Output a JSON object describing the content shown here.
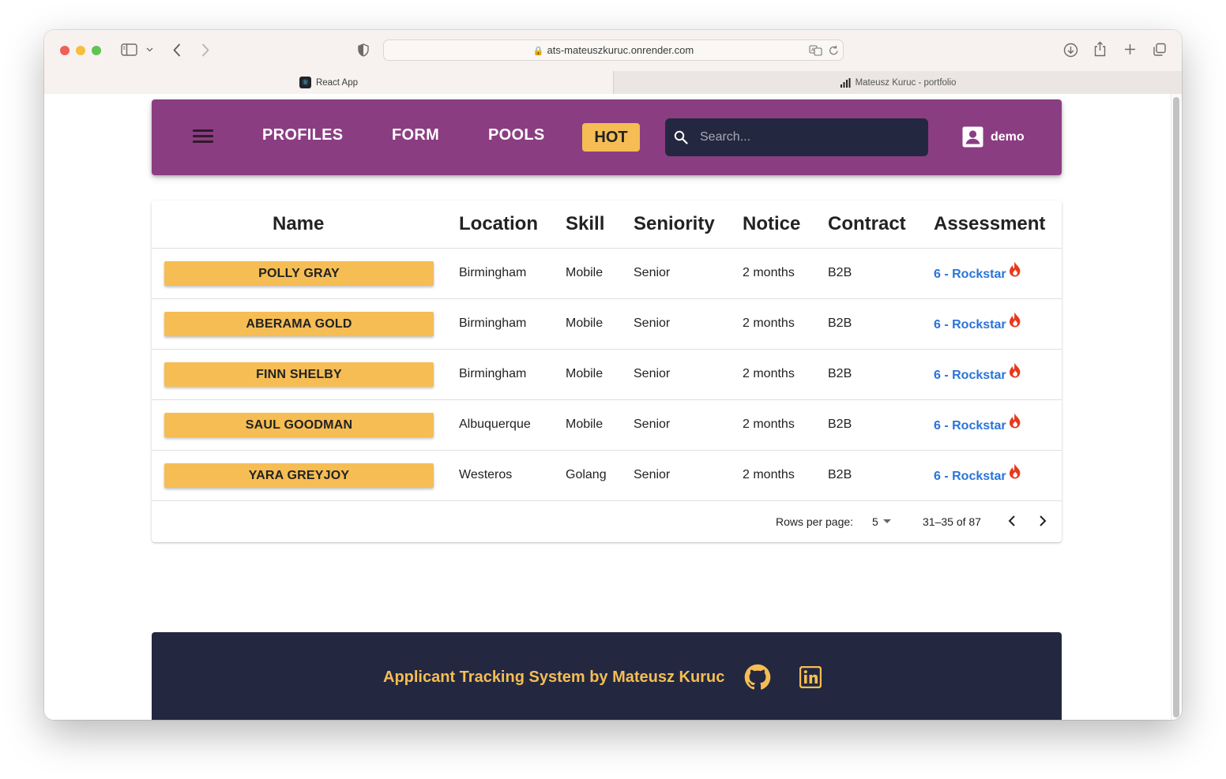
{
  "browser": {
    "url": "ats-mateuszkuruc.onrender.com",
    "tabs": [
      {
        "label": "React App"
      },
      {
        "label": "Mateusz Kuruc - portfolio"
      }
    ]
  },
  "appbar": {
    "nav": [
      "PROFILES",
      "FORM",
      "POOLS"
    ],
    "hot_label": "HOT",
    "search_placeholder": "Search...",
    "user": "demo"
  },
  "table": {
    "headers": [
      "Name",
      "Location",
      "Skill",
      "Seniority",
      "Notice",
      "Contract",
      "Assessment"
    ],
    "rows": [
      {
        "name": "POLLY GRAY",
        "location": "Birmingham",
        "skill": "Mobile",
        "seniority": "Senior",
        "notice": "2 months",
        "contract": "B2B",
        "assessment": "6 - Rockstar"
      },
      {
        "name": "ABERAMA GOLD",
        "location": "Birmingham",
        "skill": "Mobile",
        "seniority": "Senior",
        "notice": "2 months",
        "contract": "B2B",
        "assessment": "6 - Rockstar"
      },
      {
        "name": "FINN SHELBY",
        "location": "Birmingham",
        "skill": "Mobile",
        "seniority": "Senior",
        "notice": "2 months",
        "contract": "B2B",
        "assessment": "6 - Rockstar"
      },
      {
        "name": "SAUL GOODMAN",
        "location": "Albuquerque",
        "skill": "Mobile",
        "seniority": "Senior",
        "notice": "2 months",
        "contract": "B2B",
        "assessment": "6 - Rockstar"
      },
      {
        "name": "YARA GREYJOY",
        "location": "Westeros",
        "skill": "Golang",
        "seniority": "Senior",
        "notice": "2 months",
        "contract": "B2B",
        "assessment": "6 - Rockstar"
      }
    ],
    "pagination": {
      "rows_per_page_label": "Rows per page:",
      "rows_per_page": "5",
      "range": "31–35 of 87"
    }
  },
  "footer": {
    "text": "Applicant Tracking System by Mateusz Kuruc",
    "icons": [
      "github-icon",
      "linkedin-icon"
    ]
  },
  "colors": {
    "appbar": "#8b3d82",
    "accent": "#f5bd54",
    "dark": "#232840",
    "link": "#2a74d8",
    "fire": "#e8391d"
  }
}
